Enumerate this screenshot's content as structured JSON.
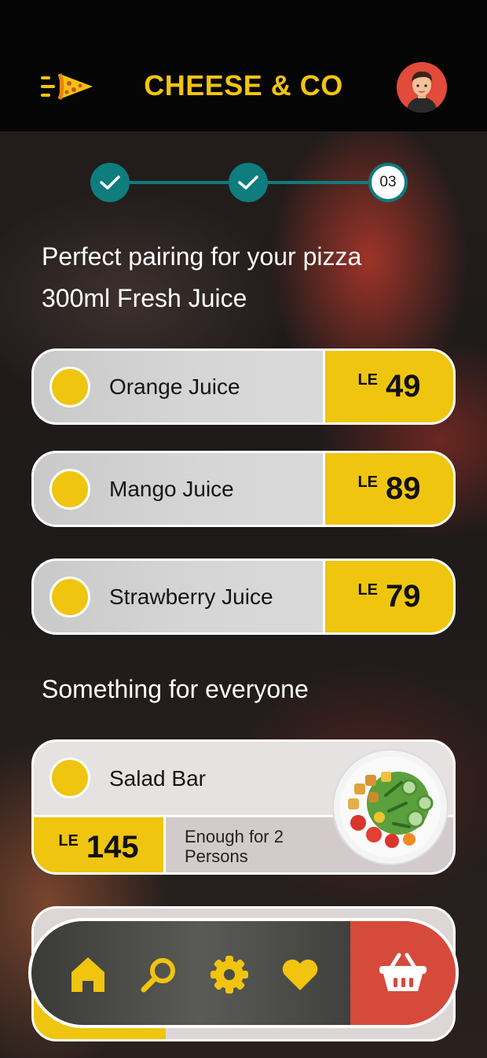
{
  "header": {
    "brand": "CHEESE & CO"
  },
  "stepper": {
    "steps": [
      {
        "state": "done",
        "label": ""
      },
      {
        "state": "done",
        "label": ""
      },
      {
        "state": "current",
        "label": "03"
      }
    ]
  },
  "juices": {
    "title_line1": "Perfect pairing for your pizza",
    "title_line2": "300ml Fresh Juice",
    "items": [
      {
        "name": "Orange Juice",
        "currency": "LE",
        "price": "49"
      },
      {
        "name": "Mango Juice",
        "currency": "LE",
        "price": "89"
      },
      {
        "name": "Strawberry Juice",
        "currency": "LE",
        "price": "79"
      }
    ]
  },
  "sides": {
    "title": "Something for everyone",
    "items": [
      {
        "name": "Salad Bar",
        "currency": "LE",
        "price": "145",
        "note": "Enough for 2 Persons"
      }
    ]
  },
  "colors": {
    "accent": "#f0c510",
    "teal": "#0f7c7d",
    "cart": "#d64a3c"
  },
  "nav": {
    "icons": [
      "home-icon",
      "search-icon",
      "settings-icon",
      "heart-icon",
      "basket-icon"
    ]
  }
}
